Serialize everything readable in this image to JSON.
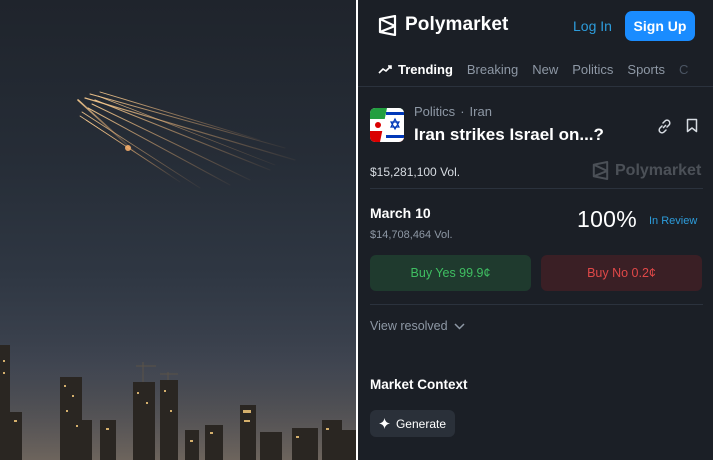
{
  "photo": {
    "alt": ""
  },
  "header": {
    "brand": "Polymarket",
    "login_label": "Log In",
    "signup_label": "Sign Up"
  },
  "tabs": [
    {
      "label": "Trending",
      "active": true
    },
    {
      "label": "Breaking"
    },
    {
      "label": "New"
    },
    {
      "label": "Politics"
    },
    {
      "label": "Sports"
    },
    {
      "label": "C"
    }
  ],
  "market": {
    "category": "Politics",
    "subcategory": "Iran",
    "title": "Iran strikes Israel on...?",
    "volume": "$15,281,100 Vol.",
    "watermark": "Polymarket"
  },
  "outcome": {
    "label": "March 10",
    "volume": "$14,708,464 Vol.",
    "percent": "100%",
    "status": "In Review",
    "buy_yes": "Buy Yes 99.9¢",
    "buy_no": "Buy No 0.2¢"
  },
  "view_resolved": "View resolved",
  "context": {
    "title": "Market Context",
    "generate_label": "Generate"
  },
  "colors": {
    "accent": "#1a8cff",
    "link": "#2d9cdb",
    "yes": "#3fbf62",
    "no": "#e04848",
    "panel_bg": "#1b1f26"
  }
}
